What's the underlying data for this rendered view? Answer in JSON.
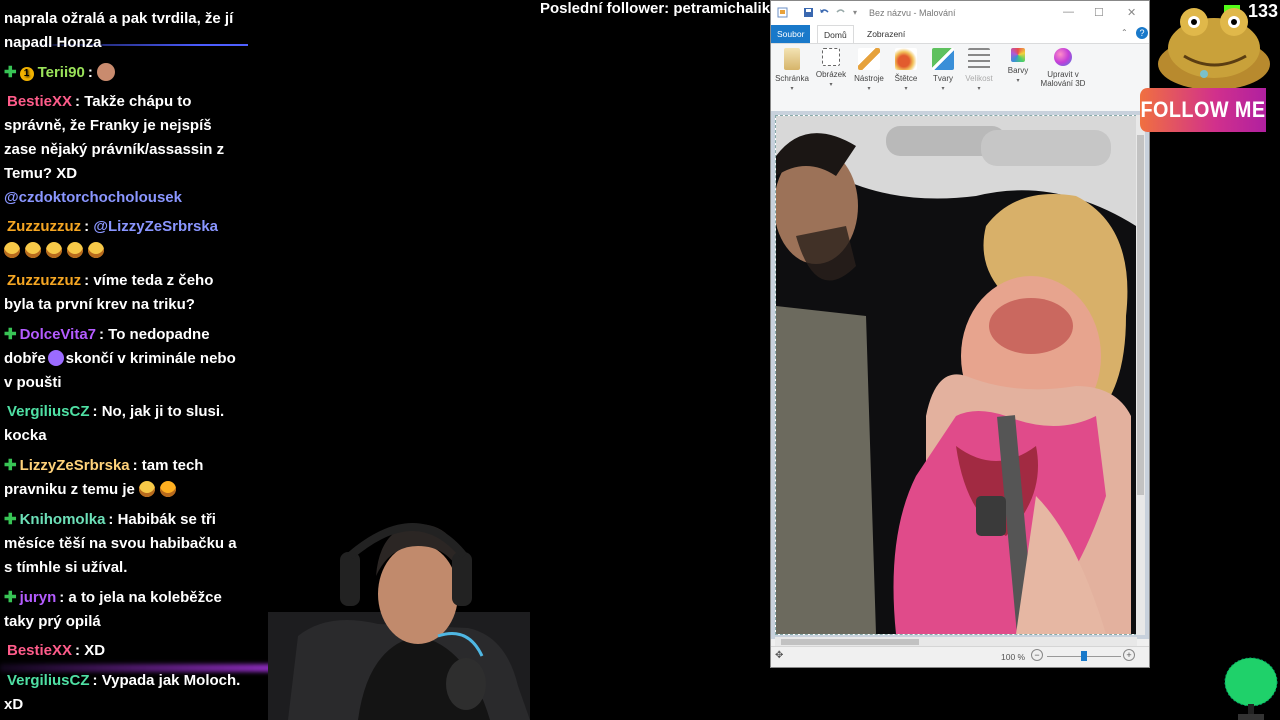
{
  "follower_banner": "Poslední follower: petramichalikova",
  "viewers": {
    "count": "133"
  },
  "follow_me": "FOLLOW ME",
  "chat": {
    "messages": [
      {
        "text": "naprala ožralá a pak tvrdila, že jí napadl Honza"
      },
      {
        "user": "Terii90",
        "text": ":"
      },
      {
        "user": "BestieXX",
        "text": ": Takže chápu to správně, že Franky je nejspíš zase nějaký právník/assassin z Temu? XD"
      },
      {
        "text": "@czdoktorchocholousek"
      },
      {
        "user": "Zuzzuzzuz",
        "mention": "@LizzyZeSrbrska"
      },
      {
        "user": "Zuzzuzzuz",
        "text": ": víme teda z čeho byla ta první krev na triku?"
      },
      {
        "user": "DolceVita7",
        "text_a": ": To nedopadne dobře",
        "text_b": "skončí v kriminále nebo v poušti"
      },
      {
        "user": "VergiliusCZ",
        "text": ": No, jak ji to slusi. kocka"
      },
      {
        "user": "LizzyZeSrbrska",
        "text": ": tam tech pravniku z temu je"
      },
      {
        "user": "Knihomolka",
        "text": ": Habibák se tři měsíce těší na svou habibačku a s tímhle si užíval."
      },
      {
        "user": "juryn",
        "text": ": a to jela na koleběžce taky prý opilá"
      },
      {
        "user": "BestieXX",
        "text": ": XD"
      },
      {
        "user": "VergiliusCZ",
        "text": ": Vypada jak Moloch. xD"
      }
    ],
    "badge_number": "1"
  },
  "paint": {
    "title": "Bez názvu - Malování",
    "tabs": [
      "Soubor",
      "Domů",
      "Zobrazení"
    ],
    "tools": [
      {
        "label": "Schránka"
      },
      {
        "label": "Obrázek"
      },
      {
        "label": "Nástroje"
      },
      {
        "label": "Štětce"
      },
      {
        "label": "Tvary"
      },
      {
        "label": "Velikost"
      },
      {
        "label": "Barvy"
      },
      {
        "label": "Upravit v Malování 3D"
      }
    ],
    "zoom": "100 %",
    "zoom_slider_fraction": 0.5
  },
  "colors": {
    "user_pink": "#ff5c8a",
    "user_orange": "#f5a623",
    "user_purple": "#b45cff",
    "user_green": "#4fe0a4",
    "user_yellow_green": "#9be35a",
    "user_light_green": "#6de0b8",
    "user_gold": "#ffd27a",
    "paint_blue": "#1979ca"
  },
  "icons": [
    "plus-badge-icon",
    "emoji-icon",
    "kick-icon",
    "toad-mascot-icon",
    "tree-icon"
  ]
}
